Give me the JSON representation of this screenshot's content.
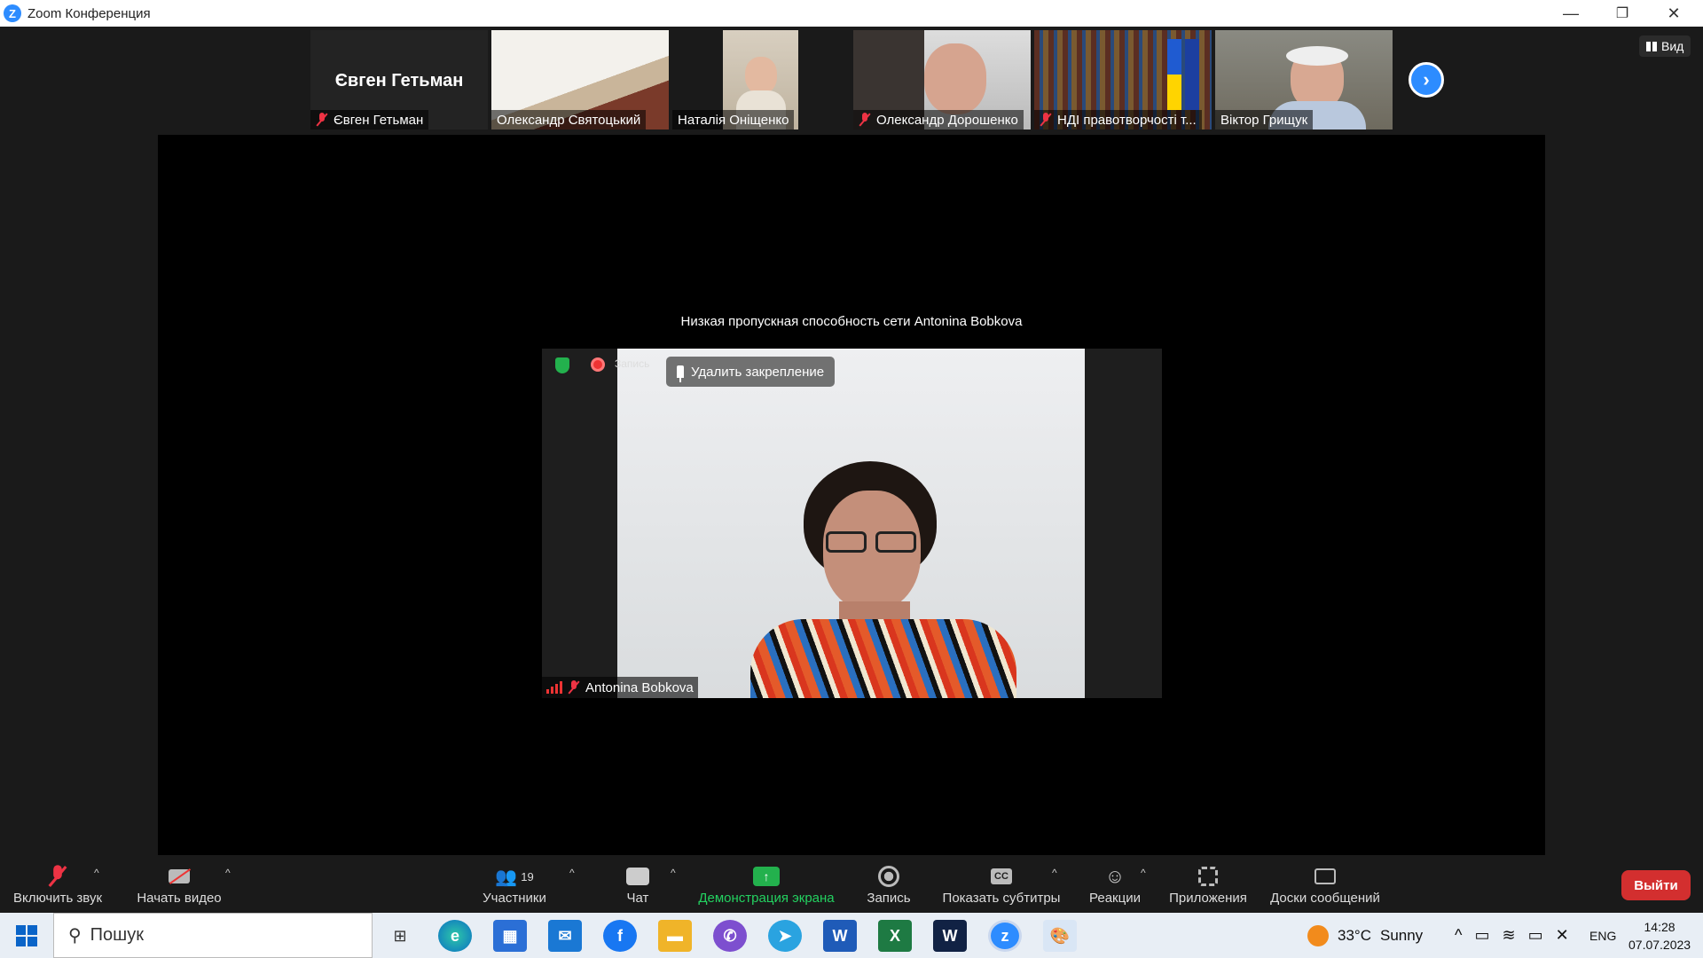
{
  "window": {
    "title": "Zoom Конференция",
    "minimize": "—",
    "restore": "❐",
    "close": "✕"
  },
  "view_button": "Вид",
  "participants": [
    {
      "name": "Євген Гетьман",
      "big_name": "Євген Гетьман",
      "muted": true
    },
    {
      "name": "Олександр Святоцький",
      "muted": false
    },
    {
      "name": "Наталія Оніщенко",
      "muted": false
    },
    {
      "name": "Олександр Дорошенко",
      "muted": true
    },
    {
      "name": "НДІ правотворчості т...",
      "muted": true
    },
    {
      "name": "Віктор Грищук",
      "muted": false
    }
  ],
  "next_arrow": "›",
  "main_video": {
    "low_bandwidth": "Низкая пропускная способность сети Antonina Bobkova",
    "record_label": "Запись",
    "unpin_label": "Удалить закрепление",
    "speaker_name": "Antonina Bobkova"
  },
  "toolbar": {
    "unmute": "Включить звук",
    "start_video": "Начать видео",
    "participants": "Участники",
    "participants_count": "19",
    "chat": "Чат",
    "share": "Демонстрация экрана",
    "record": "Запись",
    "captions": "Показать субтитры",
    "captions_icon": "CC",
    "reactions": "Реакции",
    "apps": "Приложения",
    "whiteboards": "Доски сообщений",
    "leave": "Выйти",
    "colors": {
      "share": "#23d160",
      "leave": "#d32f2f",
      "accent": "#2d8cff"
    }
  },
  "taskbar": {
    "search_placeholder": "Пошук",
    "weather_temp": "33°C",
    "weather_desc": "Sunny",
    "lang": "ENG",
    "time": "14:28",
    "date": "07.07.2023",
    "apps": [
      "task-view-icon",
      "edge-icon",
      "store-icon",
      "mail-icon",
      "facebook-icon",
      "file-explorer-icon",
      "viber-icon",
      "telegram-icon",
      "word-icon",
      "excel-icon",
      "webex-icon",
      "zoom-icon",
      "paint-icon"
    ]
  }
}
